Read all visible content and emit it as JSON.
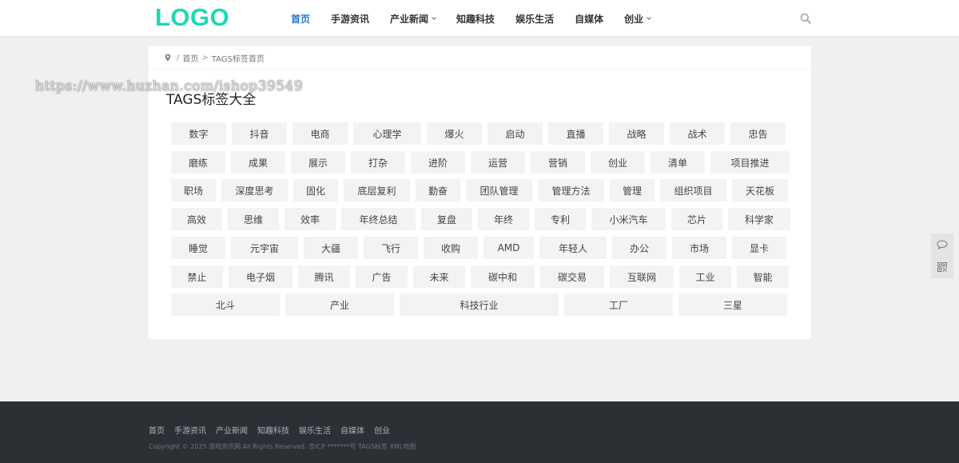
{
  "header": {
    "logo": "LOGO",
    "nav": [
      {
        "label": "首页",
        "active": true,
        "dropdown": false
      },
      {
        "label": "手游资讯",
        "active": false,
        "dropdown": false
      },
      {
        "label": "产业新闻",
        "active": false,
        "dropdown": true
      },
      {
        "label": "知趣科技",
        "active": false,
        "dropdown": false
      },
      {
        "label": "娱乐生活",
        "active": false,
        "dropdown": false
      },
      {
        "label": "自媒体",
        "active": false,
        "dropdown": false
      },
      {
        "label": "创业",
        "active": false,
        "dropdown": true
      }
    ],
    "search_icon": "search-icon"
  },
  "breadcrumb": {
    "icon": "map-pin-icon",
    "sep1": "/",
    "home": "首页",
    "sep2": ">",
    "current": "TAGS标签首页"
  },
  "page_title": "TAGS标签大全",
  "watermark": "https://www.huzhan.com/ishop39549",
  "tags": [
    [
      "数字",
      "抖音",
      "电商",
      "心理学",
      "爆火",
      "启动",
      "直播",
      "战略",
      "战术",
      "忠告"
    ],
    [
      "磨练",
      "成果",
      "展示",
      "打杂",
      "进阶",
      "运营",
      "营销",
      "创业",
      "清单",
      "项目推进"
    ],
    [
      "职场",
      "深度思考",
      "固化",
      "底层复利",
      "勤奋",
      "团队管理",
      "管理方法",
      "管理",
      "组织项目",
      "天花板"
    ],
    [
      "高效",
      "思维",
      "效率",
      "年终总结",
      "复盘",
      "年终",
      "专利",
      "小米汽车",
      "芯片",
      "科学家"
    ],
    [
      "睡觉",
      "元宇宙",
      "大疆",
      "飞行",
      "收购",
      "AMD",
      "年轻人",
      "办公",
      "市场",
      "显卡"
    ],
    [
      "禁止",
      "电子烟",
      "腾讯",
      "广告",
      "未来",
      "碳中和",
      "碳交易",
      "互联网",
      "工业",
      "智能"
    ],
    [
      "北斗",
      "产业",
      "科技行业",
      "工厂",
      "三星"
    ]
  ],
  "sidebar": {
    "comment_icon": "chat-bubble-icon",
    "qrcode_icon": "qrcode-icon"
  },
  "footer": {
    "nav": [
      "首页",
      "手游资讯",
      "产业新闻",
      "知趣科技",
      "娱乐生活",
      "自媒体",
      "创业"
    ],
    "copyright": "Copyright © 2025 游戏资讯网 All Rights Reserved.   京ICP *******号 TAGS标签 XML地图"
  },
  "colors": {
    "logo": "#1fd7b4",
    "nav_active": "#2478c7",
    "footer_bg": "#2b3035",
    "page_bg": "#f0f0f0",
    "tag_bg": "#f3f3f3"
  }
}
